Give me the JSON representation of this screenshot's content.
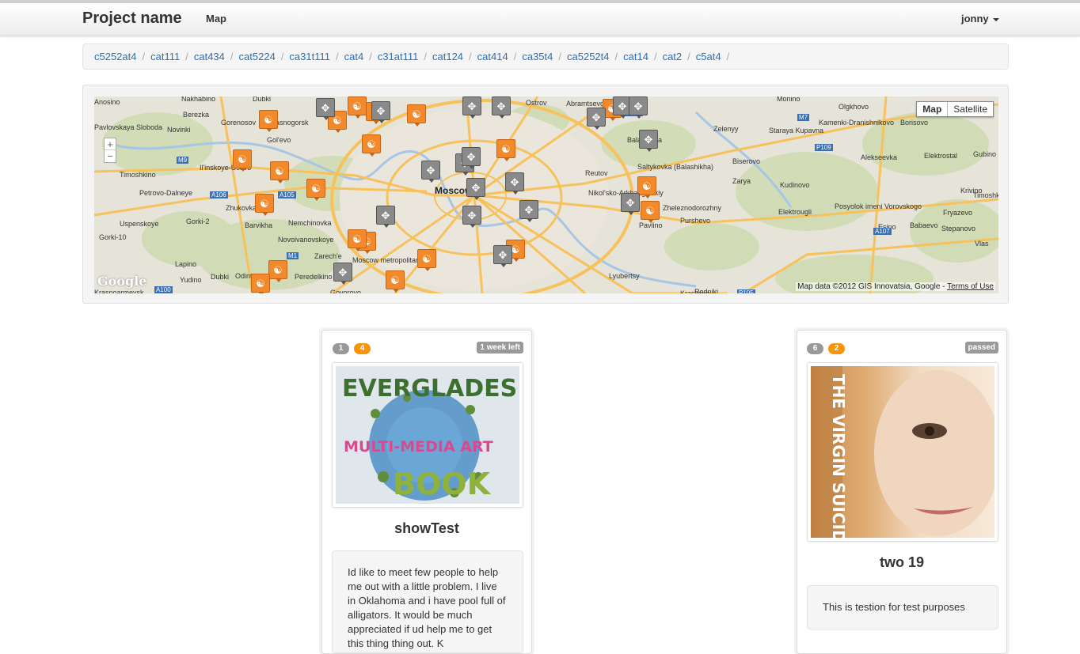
{
  "navbar": {
    "brand": "Project name",
    "links": [
      "Map"
    ],
    "user": "jonny"
  },
  "breadcrumb": [
    "c5252at4",
    "cat111",
    "cat434",
    "cat5224",
    "ca31t111",
    "cat4",
    "c31at111",
    "cat124",
    "cat414",
    "ca35t4",
    "ca5252t4",
    "cat14",
    "cat2",
    "c5at4"
  ],
  "breadcrumb_separator": "/",
  "map": {
    "type_buttons": {
      "map": "Map",
      "satellite": "Satellite"
    },
    "zoom_in": "+",
    "zoom_out": "−",
    "logo": "Google",
    "credit": "Map data ©2012 GIS Innovatsia, Google - ",
    "terms": "Terms of Use",
    "colors": {
      "road": "#f7c15c",
      "water": "#a6c6e6",
      "park": "#cfdcb4",
      "marker_people": "#f28a2c",
      "marker_cluster": "#8a8a8a"
    },
    "places": [
      "Anosino",
      "Nakhabino",
      "Berezka",
      "Gorenosov",
      "Krasnogorsk",
      "Pavlovskaya Sloboda",
      "Novinki",
      "Gol'evo",
      "Timoshkino",
      "Il'inskoye-Usovo",
      "Petrovo-Dalneye",
      "Zhukovka",
      "Uspenskoye",
      "Gorki-2",
      "Barvikha",
      "Nemchinovka",
      "Novoivanovskoye",
      "Zarech'e",
      "Gorki-10",
      "Lapino",
      "Yudino",
      "Dubki",
      "Odintsovo",
      "Peredelkino",
      "Moscow metropolitan",
      "Govorovo",
      "Moscow",
      "Ostrov",
      "Abramtsevo",
      "Balashikha",
      "Saltykovka (Balashikha)",
      "Reutov",
      "Nikol'sko-Arkhangelskiy",
      "Zheleznodorozhny",
      "Purshevo",
      "Pavlino",
      "Lyubertsy",
      "Monino",
      "Olgkhovo",
      "Kamenki-Dranishnikovo",
      "Borisovo",
      "Zelenyy",
      "Staraya Kupavna",
      "Biserovo",
      "Zarya",
      "Kudinovo",
      "Elektrostal",
      "Alekseevka",
      "Elektrougli",
      "Posyolok imeni Vorovskogo",
      "Esino",
      "Babaevo",
      "Fryazevo",
      "Stepanovo",
      "Krivino",
      "Gubino",
      "Vlas",
      "Kraskovo",
      "Rodniki",
      "Dubki",
      "Krasnoarmeysk",
      "Timoshkino"
    ],
    "road_labels": [
      "M9",
      "A106",
      "A105",
      "M1",
      "A100",
      "A103",
      "M7",
      "P109",
      "A107",
      "P105"
    ]
  },
  "cards": [
    {
      "badge_gray": "1",
      "badge_orange": "4",
      "status": "1 week left",
      "image_text": [
        "EVERGLADES",
        "MULTI-MEDIA ART",
        "BOOK"
      ],
      "title": "showTest",
      "description": "Id like to meet few people to help me out with a little problem. I live in Oklahoma and i have pool full of alligators. It would be much appreciated if ud help me to get this thing thing out. K"
    },
    {
      "badge_gray": "6",
      "badge_orange": "2",
      "status": "passed",
      "image_text": [
        "THE VIRGIN SUICIDES"
      ],
      "title": "two 19",
      "description": "This is testion for test purposes"
    }
  ]
}
